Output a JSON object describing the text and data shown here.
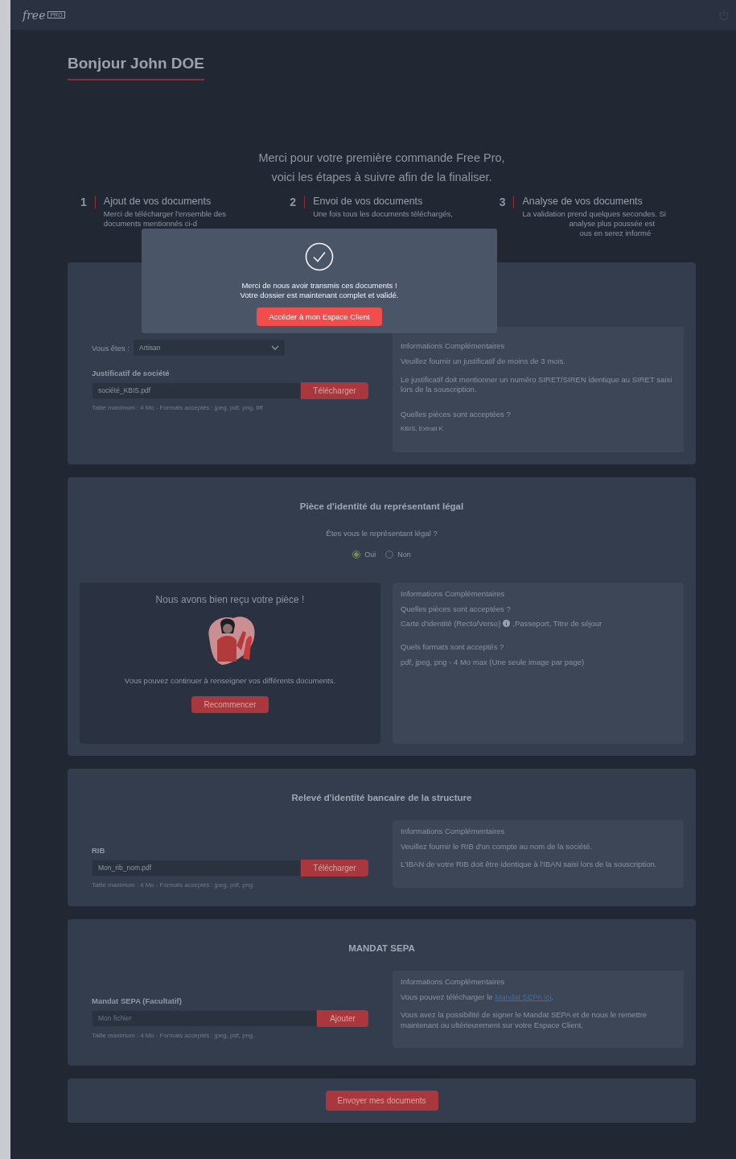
{
  "header": {
    "logo": "free",
    "logo_badge": "PRO"
  },
  "greeting": "Bonjour John DOE",
  "intro": [
    "Merci pour votre première commande Free Pro,",
    "voici les étapes à suivre afin de la finaliser."
  ],
  "steps": [
    {
      "number": "1",
      "title": "Ajout de vos documents",
      "lines": [
        "Merci de télécharger l'ensemble des",
        "documents mentionnés ci-d"
      ]
    },
    {
      "number": "2",
      "title": "Envoi de vos documents",
      "lines": [
        "Une fois tous les documents téléchargés,"
      ]
    },
    {
      "number": "3",
      "title": "Analyse de vos documents",
      "lines": [
        "La validation prend quelques secondes. Si",
        "analyse plus poussée est",
        "ous en serez informé"
      ]
    }
  ],
  "modal": {
    "message": [
      "Merci de nous avoir transmis ces documents !",
      "Votre dossier est maintenant complet et validé."
    ],
    "button": "Accéder à mon Espace Client"
  },
  "company": {
    "select_label": "Vous êtes :",
    "select_value": "Artisan",
    "field_label": "Justificatif de société",
    "file_value": "société_KBIS.pdf",
    "upload_button": "Télécharger",
    "hint": "Taille maximum : 4 Mo - Formats acceptés : jpeg, pdf, png, tiff",
    "info": {
      "title": "Informations Complémentaires",
      "paragraphs": [
        "Veuillez fournir un justificatif de moins de 3 mois.",
        "Le justificatif doit mentionner un numéro SIRET/SIREN identique au SIRET saisi lors de la souscription."
      ],
      "question": "Quelles pièces sont acceptées ?",
      "answer": "KBIS, Extrait K"
    }
  },
  "identity": {
    "title": "Pièce d'identité du représentant légal",
    "question": "Êtes vous le représentant légal ?",
    "options": [
      {
        "label": "Oui",
        "selected": true
      },
      {
        "label": "Non",
        "selected": false
      }
    ],
    "received": {
      "title": "Nous avons bien reçu votre pièce !",
      "text": "Vous pouvez continuer à renseigner vos différents documents.",
      "button": "Recommencer"
    },
    "info": {
      "title": "Informations Complémentaires",
      "q1": "Quelles pièces sont acceptées ?",
      "a1_before": "Carte d'identité (Recto/Verso)",
      "a1_after": ",Passeport, Titre de séjour",
      "q2": "Quels formats sont acceptés ?",
      "a2": "pdf, jpeg, png - 4 Mo max (Une seule image par page)"
    }
  },
  "rib": {
    "title": "Relevé d'identité bancaire de la structure",
    "field_label": "RIB",
    "file_value": "Mon_rib_nom.pdf",
    "upload_button": "Télécharger",
    "hint": "Taille maximum : 4 Mo - Formats acceptés : jpeg, pdf, png.",
    "info": {
      "title": "Informations Complémentaires",
      "paragraphs": [
        "Veuillez fournir le RIB d'un compte au nom de la société.",
        "L'IBAN de votre RIB doit être identique à l'IBAN saisi lors de la souscription."
      ]
    }
  },
  "sepa": {
    "title": "MANDAT SEPA",
    "field_label": "Mandat SEPA (Facultatif)",
    "placeholder": "Mon fichier",
    "upload_button": "Ajouter",
    "hint": "Taille maximum : 4 Mo - Formats acceptés : jpeg, pdf, png.",
    "info": {
      "title": "Informations Complémentaires",
      "p1_before": "Vous pouvez télécharger le ",
      "p1_link": "Mandat SEPA ici",
      "p1_after": ".",
      "p2": "Vous avez la possibilité de signer le Mandat SEPA et de nous le remettre maintenant ou ultérieurement sur votre Espace Client."
    }
  },
  "submit_button": "Envoyer mes documents"
}
